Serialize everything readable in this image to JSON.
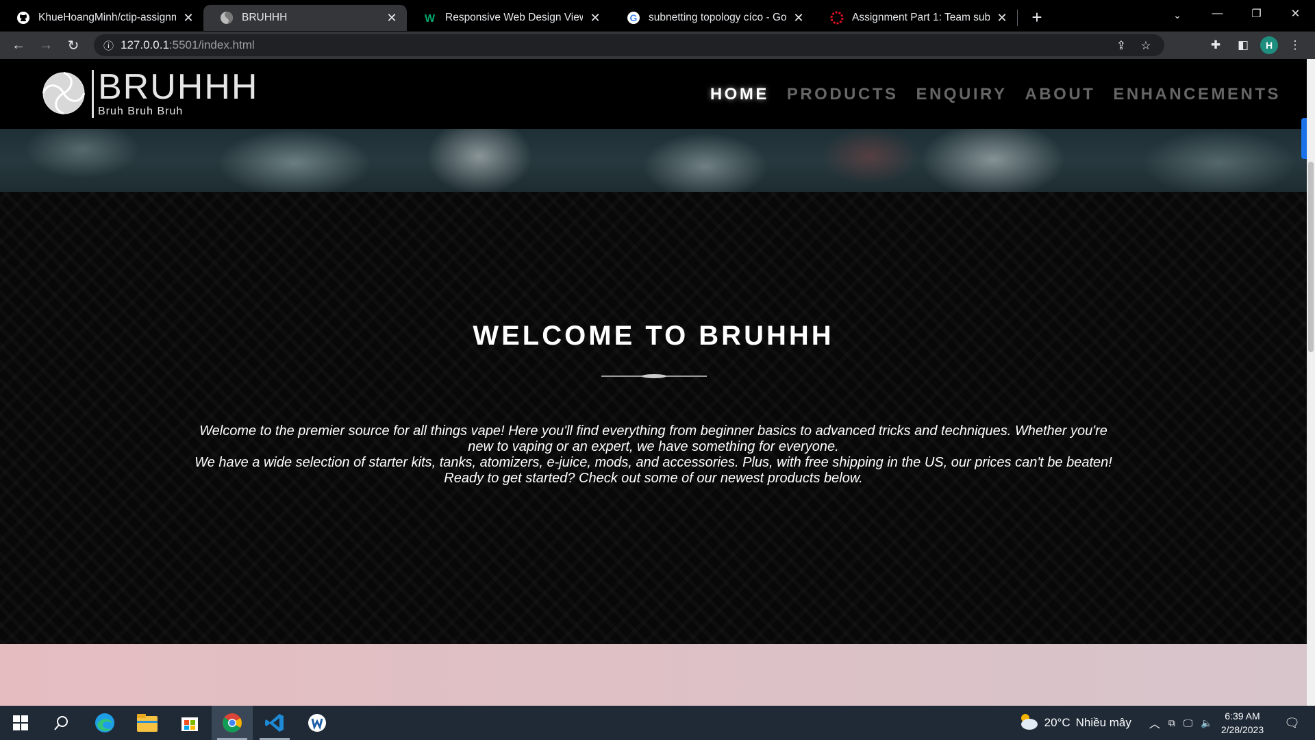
{
  "browser": {
    "tabs": [
      {
        "title": "KhueHoangMinh/ctip-assignmen",
        "favicon": "github-icon",
        "active": false
      },
      {
        "title": "BRUHHH",
        "favicon": "site-logo-icon",
        "active": true
      },
      {
        "title": "Responsive Web Design Viewpor",
        "favicon": "w3schools-icon",
        "active": false
      },
      {
        "title": "subnetting topology cíco - Goog",
        "favicon": "google-icon",
        "active": false
      },
      {
        "title": "Assignment Part 1: Team submiss",
        "favicon": "swinburne-icon",
        "active": false
      }
    ],
    "url_host": "127.0.0.1",
    "url_path": ":5501/index.html",
    "profile_initial": "H"
  },
  "site": {
    "logo_name": "BRUHHH",
    "logo_tagline": "Bruh Bruh Bruh",
    "nav": [
      {
        "label": "HOME",
        "active": true
      },
      {
        "label": "PRODUCTS",
        "active": false
      },
      {
        "label": "ENQUIRY",
        "active": false
      },
      {
        "label": "ABOUT",
        "active": false
      },
      {
        "label": "ENHANCEMENTS",
        "active": false
      }
    ],
    "welcome_title": "WELCOME TO BRUHHH",
    "welcome_lines": [
      "Welcome to the premier source for all things vape! Here you'll find everything from beginner basics to advanced tricks and techniques. Whether you're new to vaping or an expert, we have something for everyone.",
      "We have a wide selection of starter kits, tanks, atomizers, e-juice, mods, and accessories. Plus, with free shipping in the US, our prices can't be beaten!",
      "Ready to get started? Check out some of our newest products below."
    ]
  },
  "taskbar": {
    "weather_temp": "20°C",
    "weather_desc": "Nhiều mây",
    "time": "6:39 AM",
    "date": "2/28/2023"
  },
  "colors": {
    "tab_active_bg": "#35363a",
    "page_bg": "#000000",
    "nav_inactive": "#666666",
    "nav_active": "#ffffff",
    "next_section_pink": "#e5bdc1"
  }
}
